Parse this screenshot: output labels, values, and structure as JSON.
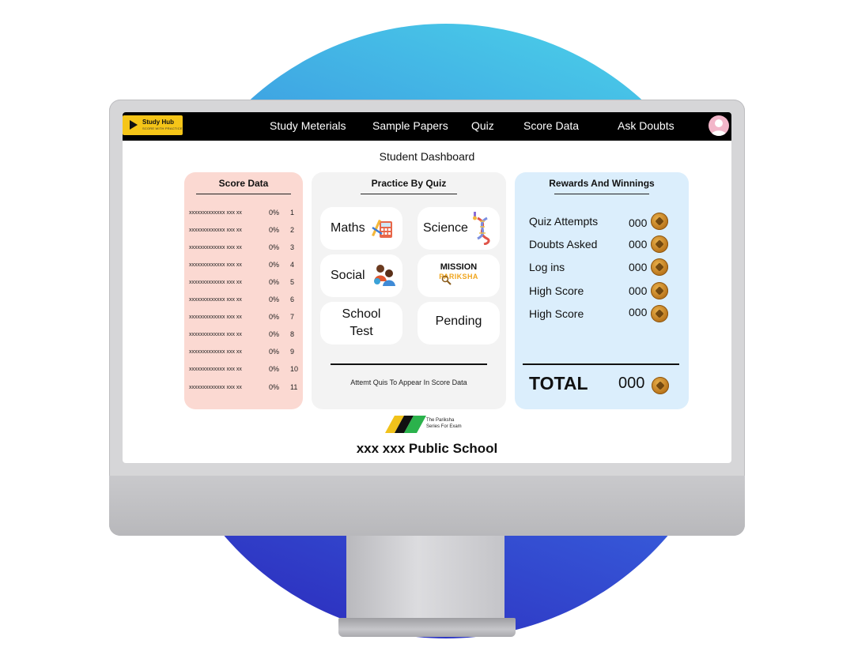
{
  "app": {
    "logo_title": "Study Hub",
    "logo_subtitle": "SCORE WITH PRACTICE"
  },
  "nav": {
    "items": [
      "Study Meterials",
      "Sample Papers",
      "Quiz",
      "Score Data",
      "Ask Doubts"
    ]
  },
  "page_title": "Student Dashboard",
  "score_panel": {
    "title": "Score Data",
    "rows": [
      {
        "text": "xxxxxxxxxxxxx xxx xx",
        "pct": "0%",
        "num": "1"
      },
      {
        "text": "xxxxxxxxxxxxx xxx xx",
        "pct": "0%",
        "num": "2"
      },
      {
        "text": "xxxxxxxxxxxxx xxx xx",
        "pct": "0%",
        "num": "3"
      },
      {
        "text": "xxxxxxxxxxxxx xxx xx",
        "pct": "0%",
        "num": "4"
      },
      {
        "text": "xxxxxxxxxxxxx xxx xx",
        "pct": "0%",
        "num": "5"
      },
      {
        "text": "xxxxxxxxxxxxx xxx xx",
        "pct": "0%",
        "num": "6"
      },
      {
        "text": "xxxxxxxxxxxxx xxx xx",
        "pct": "0%",
        "num": "7"
      },
      {
        "text": "xxxxxxxxxxxxx xxx xx",
        "pct": "0%",
        "num": "8"
      },
      {
        "text": "xxxxxxxxxxxxx xxx xx",
        "pct": "0%",
        "num": "9"
      },
      {
        "text": "xxxxxxxxxxxxx xxx xx",
        "pct": "0%",
        "num": "10"
      },
      {
        "text": "xxxxxxxxxxxxx xxx xx",
        "pct": "0%",
        "num": "11"
      }
    ]
  },
  "quiz_panel": {
    "title": "Practice By Quiz",
    "maths": "Maths",
    "science": "Science",
    "social": "Social",
    "mission_title": "MISSION",
    "mission_sub": "PARIKSHA",
    "school_test_1": "School",
    "school_test_2": "Test",
    "pending": "Pending",
    "footer": "Attemt Quis To Appear In Score Data"
  },
  "rewards_panel": {
    "title": "Rewards And Winnings",
    "items": [
      {
        "label": "Quiz Attempts",
        "value": "000"
      },
      {
        "label": "Doubts Asked",
        "value": "000"
      },
      {
        "label": "Log ins",
        "value": "000"
      },
      {
        "label": "High Score",
        "value": "000"
      },
      {
        "label": "High Score",
        "value": "000"
      }
    ],
    "total_label": "TOTAL",
    "total_value": "000"
  },
  "footer": {
    "brand_line1": "The Pariksha",
    "brand_line2": "Series For Exam",
    "school_name": "xxx xxx Public School"
  },
  "colors": {
    "navbar": "#000000",
    "logo_bg": "#f5c518",
    "score_panel": "#fbd9d2",
    "quiz_panel": "#f3f3f3",
    "rewards_panel": "#dbeefc",
    "coin": "#c8841f"
  }
}
